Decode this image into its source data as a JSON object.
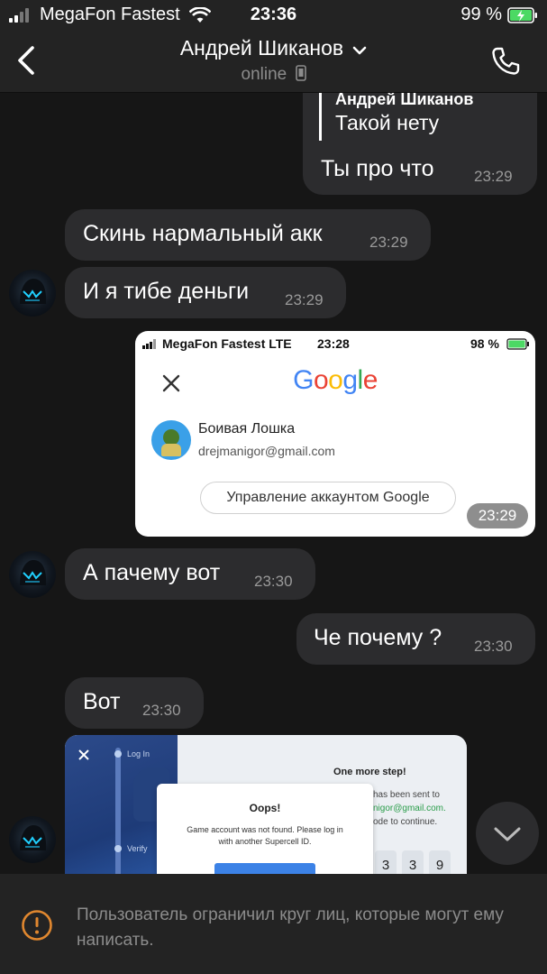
{
  "status_bar": {
    "carrier": "MegaFon Fastest",
    "time": "23:36",
    "battery": "99 %"
  },
  "header": {
    "title": "Андрей Шиканов",
    "status": "online"
  },
  "messages": {
    "reply_quote": {
      "author": "Андрей Шиканов",
      "text": "Такой нету"
    },
    "m1": {
      "text": "Ты про что",
      "time": "23:29"
    },
    "m2": {
      "text": "Скинь нармальный акк",
      "time": "23:29"
    },
    "m3": {
      "text": "И я тибе деньги",
      "time": "23:29"
    },
    "m5": {
      "text": "А пачему вот",
      "time": "23:30"
    },
    "m6": {
      "text": "Че почему ?",
      "time": "23:30"
    },
    "m7": {
      "text": "Вот",
      "time": "23:30"
    }
  },
  "screenshot1": {
    "carrier": "MegaFon Fastest LTE",
    "time": "23:28",
    "battery": "98 %",
    "logo": "Google",
    "account_name": "Боивая Лошка",
    "account_email": "drejmanigor@gmail.com",
    "manage_button": "Управление аккаунтом Google",
    "msg_time": "23:29"
  },
  "screenshot2": {
    "log_in": "Log In",
    "verify": "Verify",
    "heading": "One more step!",
    "line1": "has been sent to",
    "line2": "nigor@gmail.com.",
    "line3": "ode to continue.",
    "digits": [
      "3",
      "3",
      "9"
    ],
    "dialog_title": "Oops!",
    "dialog_text_1": "Game account was not found. Please log in",
    "dialog_text_2": "with another Supercell ID."
  },
  "footer": {
    "text": "Пользователь ограничил круг лиц, которые могут ему написать."
  },
  "colors": {
    "background": "#161616",
    "bar": "#232323",
    "bubble": "#2c2c2e",
    "warning": "#e0872f",
    "google_blue": "#4285f4",
    "battery_green": "#4cd964"
  }
}
